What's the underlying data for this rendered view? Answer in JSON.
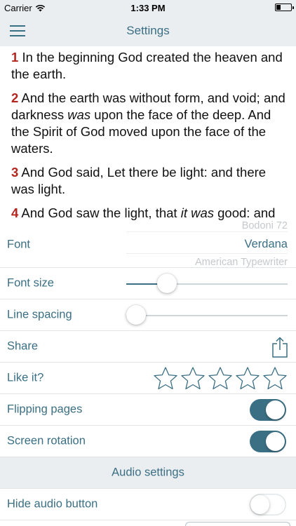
{
  "status_bar": {
    "carrier": "Carrier",
    "time": "1:33 PM"
  },
  "nav": {
    "title": "Settings"
  },
  "reader": {
    "verses": [
      {
        "num": "1",
        "parts": [
          {
            "t": "In the beginning God created the heaven and the earth."
          }
        ]
      },
      {
        "num": "2",
        "parts": [
          {
            "t": "And the earth was without form, and void; and darkness "
          },
          {
            "t": "was",
            "i": true
          },
          {
            "t": " upon the face of the deep. And the Spirit of God moved upon the face of the waters."
          }
        ]
      },
      {
        "num": "3",
        "parts": [
          {
            "t": "And God said, Let there be light: and there was light."
          }
        ]
      },
      {
        "num": "4",
        "parts": [
          {
            "t": "And God saw the light, that "
          },
          {
            "t": "it was",
            "i": true
          },
          {
            "t": " good: and God divided the light from the darkness."
          }
        ]
      }
    ]
  },
  "settings": {
    "font": {
      "label": "Font",
      "options": [
        "Bodoni 72",
        "Verdana",
        "American Typewriter"
      ],
      "selected": "Verdana"
    },
    "font_size": {
      "label": "Font size",
      "value": 0.25
    },
    "line_spacing": {
      "label": "Line spacing",
      "value": 0.06
    },
    "share": {
      "label": "Share"
    },
    "like": {
      "label": "Like it?",
      "stars_total": 5,
      "rating": 0
    },
    "flipping_pages": {
      "label": "Flipping pages",
      "on": true
    },
    "screen_rotation": {
      "label": "Screen rotation",
      "on": true
    },
    "audio_header": "Audio settings",
    "hide_audio": {
      "label": "Hide audio button",
      "on": false
    }
  },
  "colors": {
    "accent": "#3b6f83",
    "verse_number": "#b3261e",
    "bar_bg": "#eaeef1"
  },
  "icons": [
    "wifi-icon",
    "battery-icon",
    "hamburger-menu-icon",
    "share-icon",
    "star-outline-icon"
  ]
}
